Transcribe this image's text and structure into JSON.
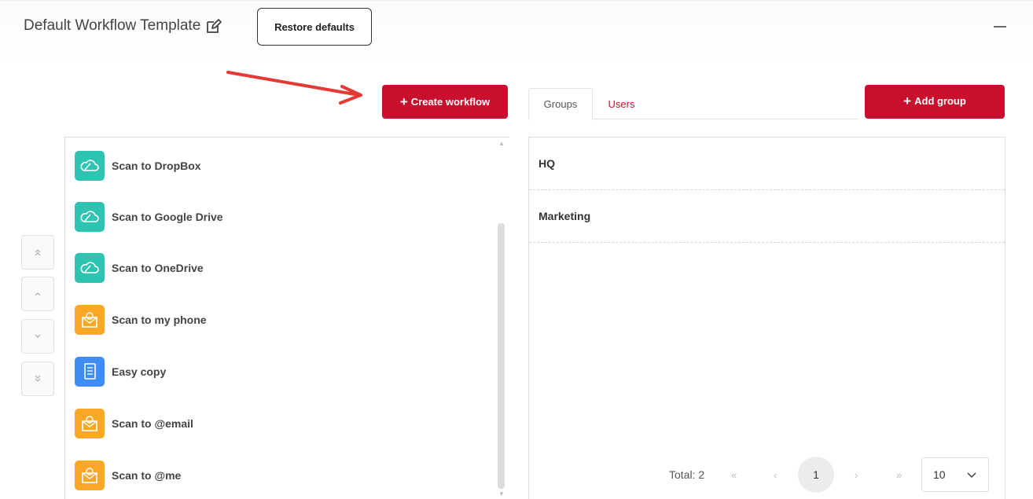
{
  "header": {
    "title": "Default Workflow Template",
    "edit_icon": "edit-icon",
    "restore_label": "Restore defaults",
    "collapse_icon": "minus-icon"
  },
  "toolbar": {
    "create_workflow_label": "Create workflow",
    "add_group_label": "Add group"
  },
  "tabs": [
    {
      "label": "Groups",
      "active": true
    },
    {
      "label": "Users",
      "active": false
    }
  ],
  "reorder_buttons": [
    "move-top-icon",
    "move-up-icon",
    "move-down-icon",
    "move-bottom-icon"
  ],
  "workflows": [
    {
      "label": "Scan to DropBox",
      "icon": "cloud-icon",
      "color": "#2fc4b2"
    },
    {
      "label": "Scan to Google Drive",
      "icon": "cloud-icon",
      "color": "#2fc4b2"
    },
    {
      "label": "Scan to OneDrive",
      "icon": "cloud-icon",
      "color": "#2fc4b2"
    },
    {
      "label": "Scan to my phone",
      "icon": "email-envelope-icon",
      "color": "#f9a825"
    },
    {
      "label": "Easy copy",
      "icon": "document-copy-icon",
      "color": "#3d8df5"
    },
    {
      "label": "Scan to @email",
      "icon": "email-envelope-icon",
      "color": "#f9a825"
    },
    {
      "label": "Scan to @me",
      "icon": "email-envelope-icon",
      "color": "#f9a825"
    }
  ],
  "groups": [
    {
      "name": "HQ"
    },
    {
      "name": "Marketing"
    }
  ],
  "pagination": {
    "total_label": "Total: 2",
    "current_page": "1",
    "per_page": "10",
    "first_icon": "«",
    "prev_icon": "‹",
    "next_icon": "›",
    "last_icon": "»"
  },
  "colors": {
    "accent": "#c8102e",
    "cloud": "#2fc4b2",
    "email": "#f9a825",
    "copy": "#3d8df5",
    "annotation_arrow": "#e53935"
  }
}
